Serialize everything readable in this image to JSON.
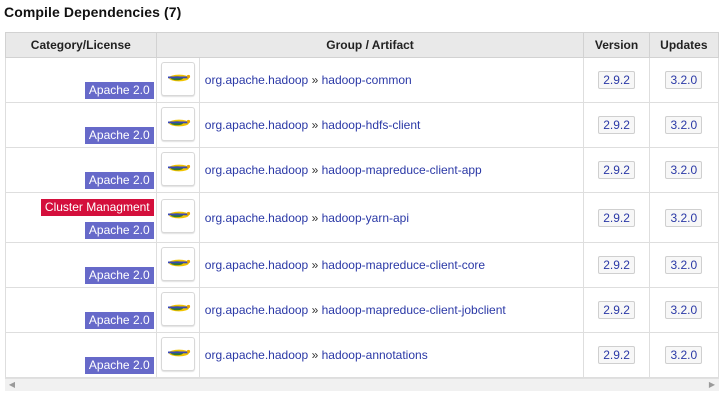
{
  "section": {
    "title": "Compile Dependencies (7)"
  },
  "table": {
    "headers": {
      "category": "Category/License",
      "artifact": "Group / Artifact",
      "version": "Version",
      "updates": "Updates"
    },
    "rows": [
      {
        "badges": [
          "Apache 2.0"
        ],
        "group": "org.apache.hadoop",
        "separator": "»",
        "artifact": "hadoop-common",
        "version": "2.9.2",
        "update": "3.2.0"
      },
      {
        "badges": [
          "Apache 2.0"
        ],
        "group": "org.apache.hadoop",
        "separator": "»",
        "artifact": "hadoop-hdfs-client",
        "version": "2.9.2",
        "update": "3.2.0"
      },
      {
        "badges": [
          "Apache 2.0"
        ],
        "group": "org.apache.hadoop",
        "separator": "»",
        "artifact": "hadoop-mapreduce-client-app",
        "version": "2.9.2",
        "update": "3.2.0"
      },
      {
        "badges": [
          "Cluster Managment",
          "Apache 2.0"
        ],
        "group": "org.apache.hadoop",
        "separator": "»",
        "artifact": "hadoop-yarn-api",
        "version": "2.9.2",
        "update": "3.2.0"
      },
      {
        "badges": [
          "Apache 2.0"
        ],
        "group": "org.apache.hadoop",
        "separator": "»",
        "artifact": "hadoop-mapreduce-client-core",
        "version": "2.9.2",
        "update": "3.2.0"
      },
      {
        "badges": [
          "Apache 2.0"
        ],
        "group": "org.apache.hadoop",
        "separator": "»",
        "artifact": "hadoop-mapreduce-client-jobclient",
        "version": "2.9.2",
        "update": "3.2.0"
      },
      {
        "badges": [
          "Apache 2.0"
        ],
        "group": "org.apache.hadoop",
        "separator": "»",
        "artifact": "hadoop-annotations",
        "version": "2.9.2",
        "update": "3.2.0"
      }
    ]
  },
  "colors": {
    "license_badge": "#6669c9",
    "category_badge": "#d40f3c",
    "link": "#2a38a6"
  },
  "icons": {
    "row_logo": "hadoop-logo-icon",
    "scroll_left": "arrow-left-icon",
    "scroll_right": "arrow-right-icon"
  }
}
